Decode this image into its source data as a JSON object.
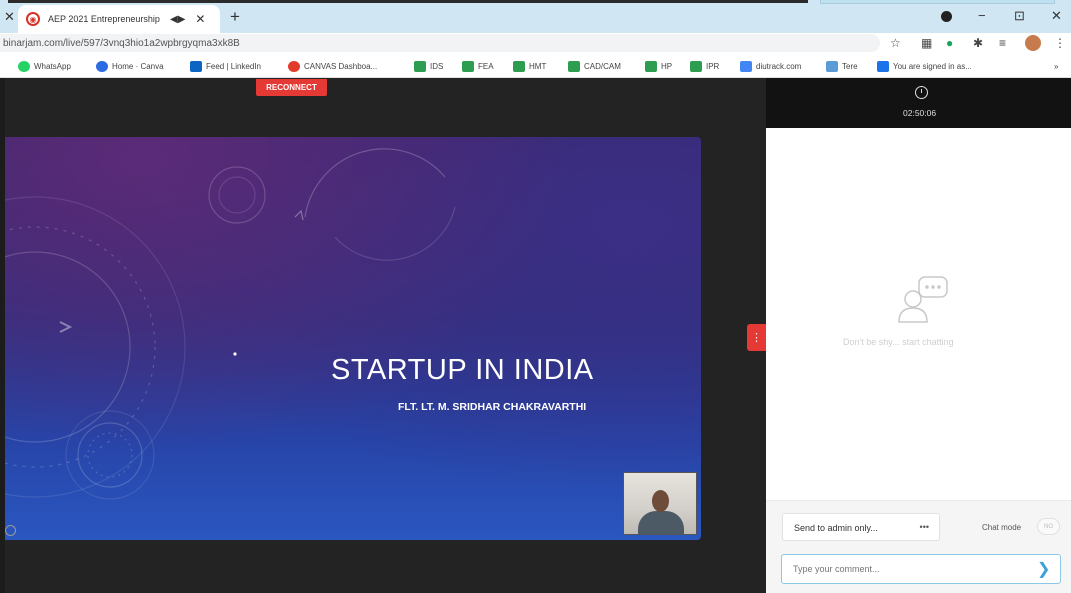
{
  "browser": {
    "tab": {
      "title": "AEP 2021 Entrepreneurship",
      "favicon": "aep-logo-icon"
    },
    "url": "binarjam.com/live/597/3vnq3hio1a2wpbrgyqma3xk8B",
    "window": {
      "minimize": "−",
      "maximize": "⊡",
      "close": "✕"
    },
    "bookmarks": [
      {
        "label": "WhatsApp",
        "color": "#25d366"
      },
      {
        "label": "Home · Canva",
        "color": "#2d6be3"
      },
      {
        "label": "Feed | LinkedIn",
        "color": "#0a66c2"
      },
      {
        "label": "CANVAS Dashboa...",
        "color": "#e13b2c"
      },
      {
        "label": "IDS",
        "color": "#2d9e4f"
      },
      {
        "label": "FEA",
        "color": "#2d9e4f"
      },
      {
        "label": "HMT",
        "color": "#2d9e4f"
      },
      {
        "label": "CAD/CAM",
        "color": "#2d9e4f"
      },
      {
        "label": "HP",
        "color": "#2d9e4f"
      },
      {
        "label": "IPR",
        "color": "#2d9e4f"
      },
      {
        "label": "diutrack.com",
        "color": "#4285f4"
      },
      {
        "label": "Tere",
        "color": "#5b9bd5"
      },
      {
        "label": "You are signed in as...",
        "color": "#1a73e8"
      }
    ],
    "more_bookmarks": "»"
  },
  "meeting": {
    "reconnect_label": "RECONNECT",
    "timer": "02:50:06",
    "slide": {
      "title": "STARTUP IN INDIA",
      "presenter": "FLT. LT. M. SRIDHAR CHAKRAVARTHI"
    },
    "chat": {
      "empty_text": "Don't be shy... start chatting",
      "send_to": "Send to admin only...",
      "send_to_more": "•••",
      "chat_mode_label": "Chat mode",
      "chat_mode_toggle": "NO",
      "comment_placeholder": "Type your comment..."
    }
  },
  "colors": {
    "accent_red": "#e53935",
    "send_blue": "#3aa0d8"
  }
}
